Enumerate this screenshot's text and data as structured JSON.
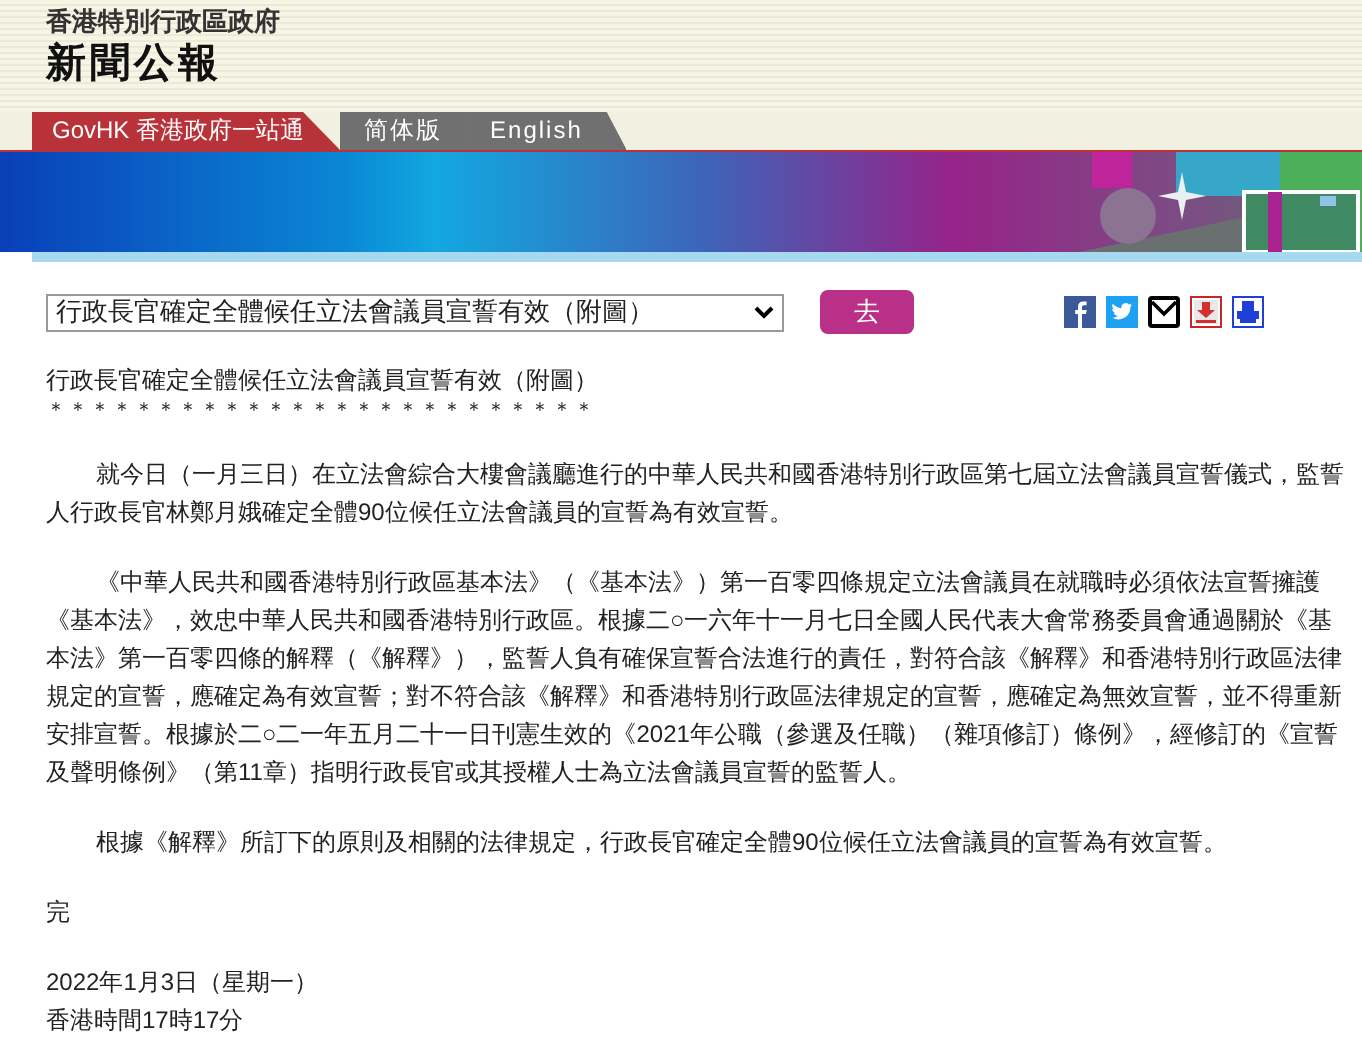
{
  "header": {
    "department": "香港特別行政區政府",
    "title": "新聞公報"
  },
  "nav": [
    {
      "label": "GovHK 香港政府一站通",
      "kind": "home"
    },
    {
      "label": "简体版",
      "kind": "lang"
    },
    {
      "label": "English",
      "kind": "lang"
    }
  ],
  "toolbar": {
    "select_value": "行政長官確定全體候任立法會議員宣誓有效（附圖）",
    "go_button": "去"
  },
  "article": {
    "title": "行政長官確定全體候任立法會議員宣誓有效（附圖）",
    "stars": "＊＊＊＊＊＊＊＊＊＊＊＊＊＊＊＊＊＊＊＊＊＊＊＊＊",
    "paragraphs": [
      "就今日（一月三日）在立法會綜合大樓會議廳進行的中華人民共和國香港特別行政區第七屆立法會議員宣誓儀式，監誓人行政長官林鄭月娥確定全體90位候任立法會議員的宣誓為有效宣誓。",
      "《中華人民共和國香港特別行政區基本法》（《基本法》）第一百零四條規定立法會議員在就職時必須依法宣誓擁護《基本法》，效忠中華人民共和國香港特別行政區。根據二○一六年十一月七日全國人民代表大會常務委員會通過關於《基本法》第一百零四條的解釋（《解釋》），監誓人負有確保宣誓合法進行的責任，對符合該《解釋》和香港特別行政區法律規定的宣誓，應確定為有效宣誓；對不符合該《解釋》和香港特別行政區法律規定的宣誓，應確定為無效宣誓，並不得重新安排宣誓。根據於二○二一年五月二十一日刊憲生效的《2021年公職（參選及任職）（雜項修訂）條例》，經修訂的《宣誓及聲明條例》（第11章）指明行政長官或其授權人士為立法會議員宣誓的監誓人。",
      "根據《解釋》所訂下的原則及相關的法律規定，行政長官確定全體90位候任立法會議員的宣誓為有效宣誓。"
    ],
    "end": "完",
    "date": "2022年1月3日（星期一）",
    "time": "香港時間17時17分"
  }
}
